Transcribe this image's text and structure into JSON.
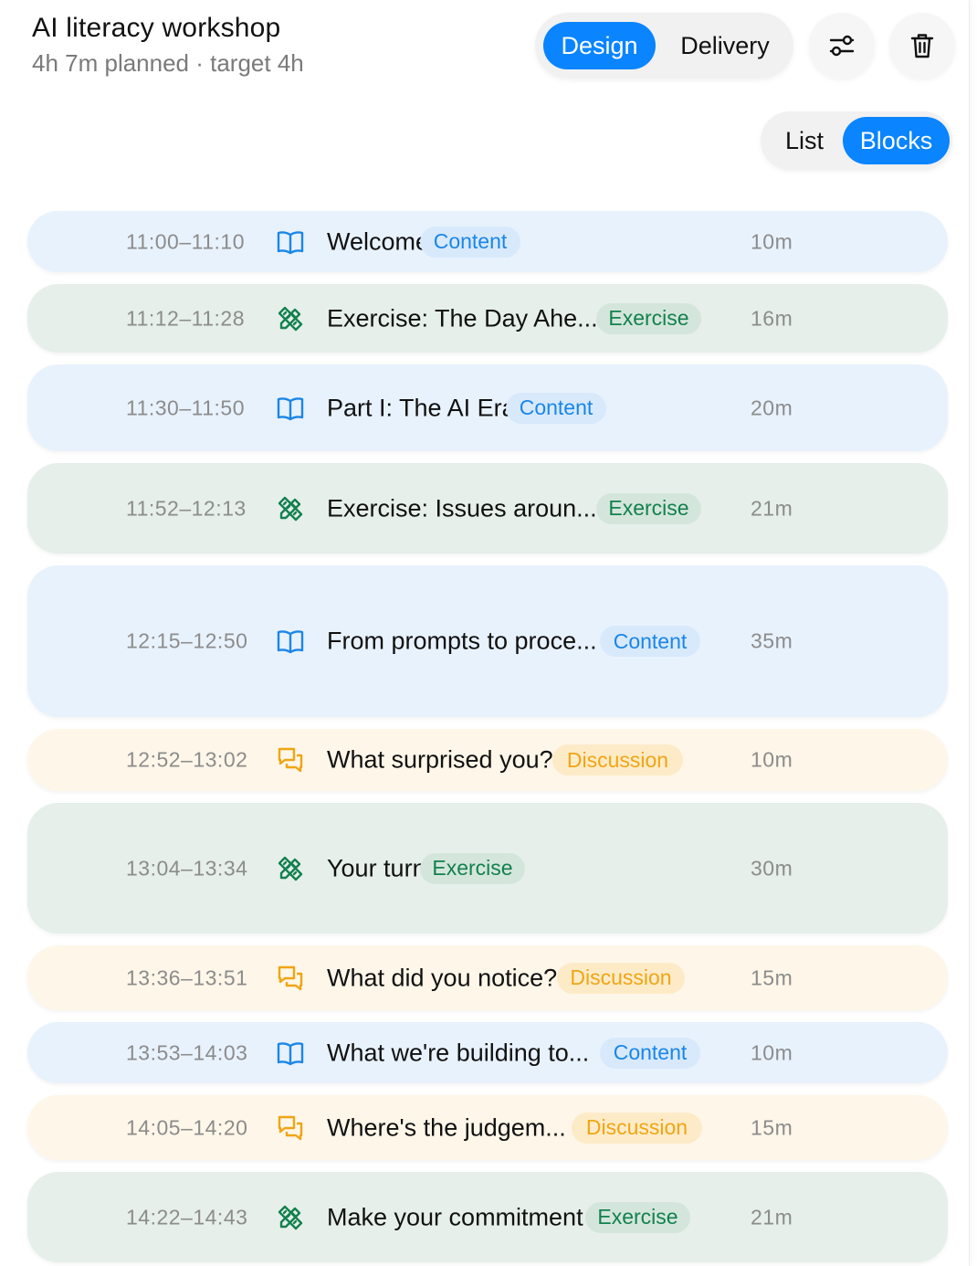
{
  "header": {
    "title": "AI literacy workshop",
    "subtitle": "4h 7m planned · target 4h"
  },
  "mode_toggle": {
    "design": "Design",
    "delivery": "Delivery",
    "selected": "Design"
  },
  "actions": {
    "settings_icon": "sliders-icon",
    "delete_icon": "trash-icon"
  },
  "view_toggle": {
    "list": "List",
    "blocks": "Blocks",
    "selected": "Blocks"
  },
  "colors": {
    "accent": "#0a84ff",
    "content": "#1a86e8",
    "exercise": "#13804f",
    "discussion": "#f0a514"
  },
  "blocks": [
    {
      "time": "11:00–11:10",
      "icon": "book-icon",
      "name": "Welcome",
      "type": "Content",
      "duration": "10m"
    },
    {
      "time": "11:12–11:28",
      "icon": "pencil-ruler-icon",
      "name": "Exercise: The Day Ahe...",
      "type": "Exercise",
      "duration": "16m"
    },
    {
      "time": "11:30–11:50",
      "icon": "book-icon",
      "name": "Part I: The AI Era",
      "type": "Content",
      "duration": "20m"
    },
    {
      "time": "11:52–12:13",
      "icon": "pencil-ruler-icon",
      "name": "Exercise: Issues aroun...",
      "type": "Exercise",
      "duration": "21m"
    },
    {
      "time": "12:15–12:50",
      "icon": "book-icon",
      "name": "From prompts to proce...",
      "type": "Content",
      "duration": "35m"
    },
    {
      "time": "12:52–13:02",
      "icon": "chat-bubbles-icon",
      "name": "What surprised you?",
      "type": "Discussion",
      "duration": "10m"
    },
    {
      "time": "13:04–13:34",
      "icon": "pencil-ruler-icon",
      "name": "Your turn",
      "type": "Exercise",
      "duration": "30m"
    },
    {
      "time": "13:36–13:51",
      "icon": "chat-bubbles-icon",
      "name": "What did you notice?",
      "type": "Discussion",
      "duration": "15m"
    },
    {
      "time": "13:53–14:03",
      "icon": "book-icon",
      "name": "What we're building to...",
      "type": "Content",
      "duration": "10m"
    },
    {
      "time": "14:05–14:20",
      "icon": "chat-bubbles-icon",
      "name": "Where's the judgem...",
      "type": "Discussion",
      "duration": "15m"
    },
    {
      "time": "14:22–14:43",
      "icon": "pencil-ruler-icon",
      "name": "Make your commitment",
      "type": "Exercise",
      "duration": "21m"
    }
  ]
}
